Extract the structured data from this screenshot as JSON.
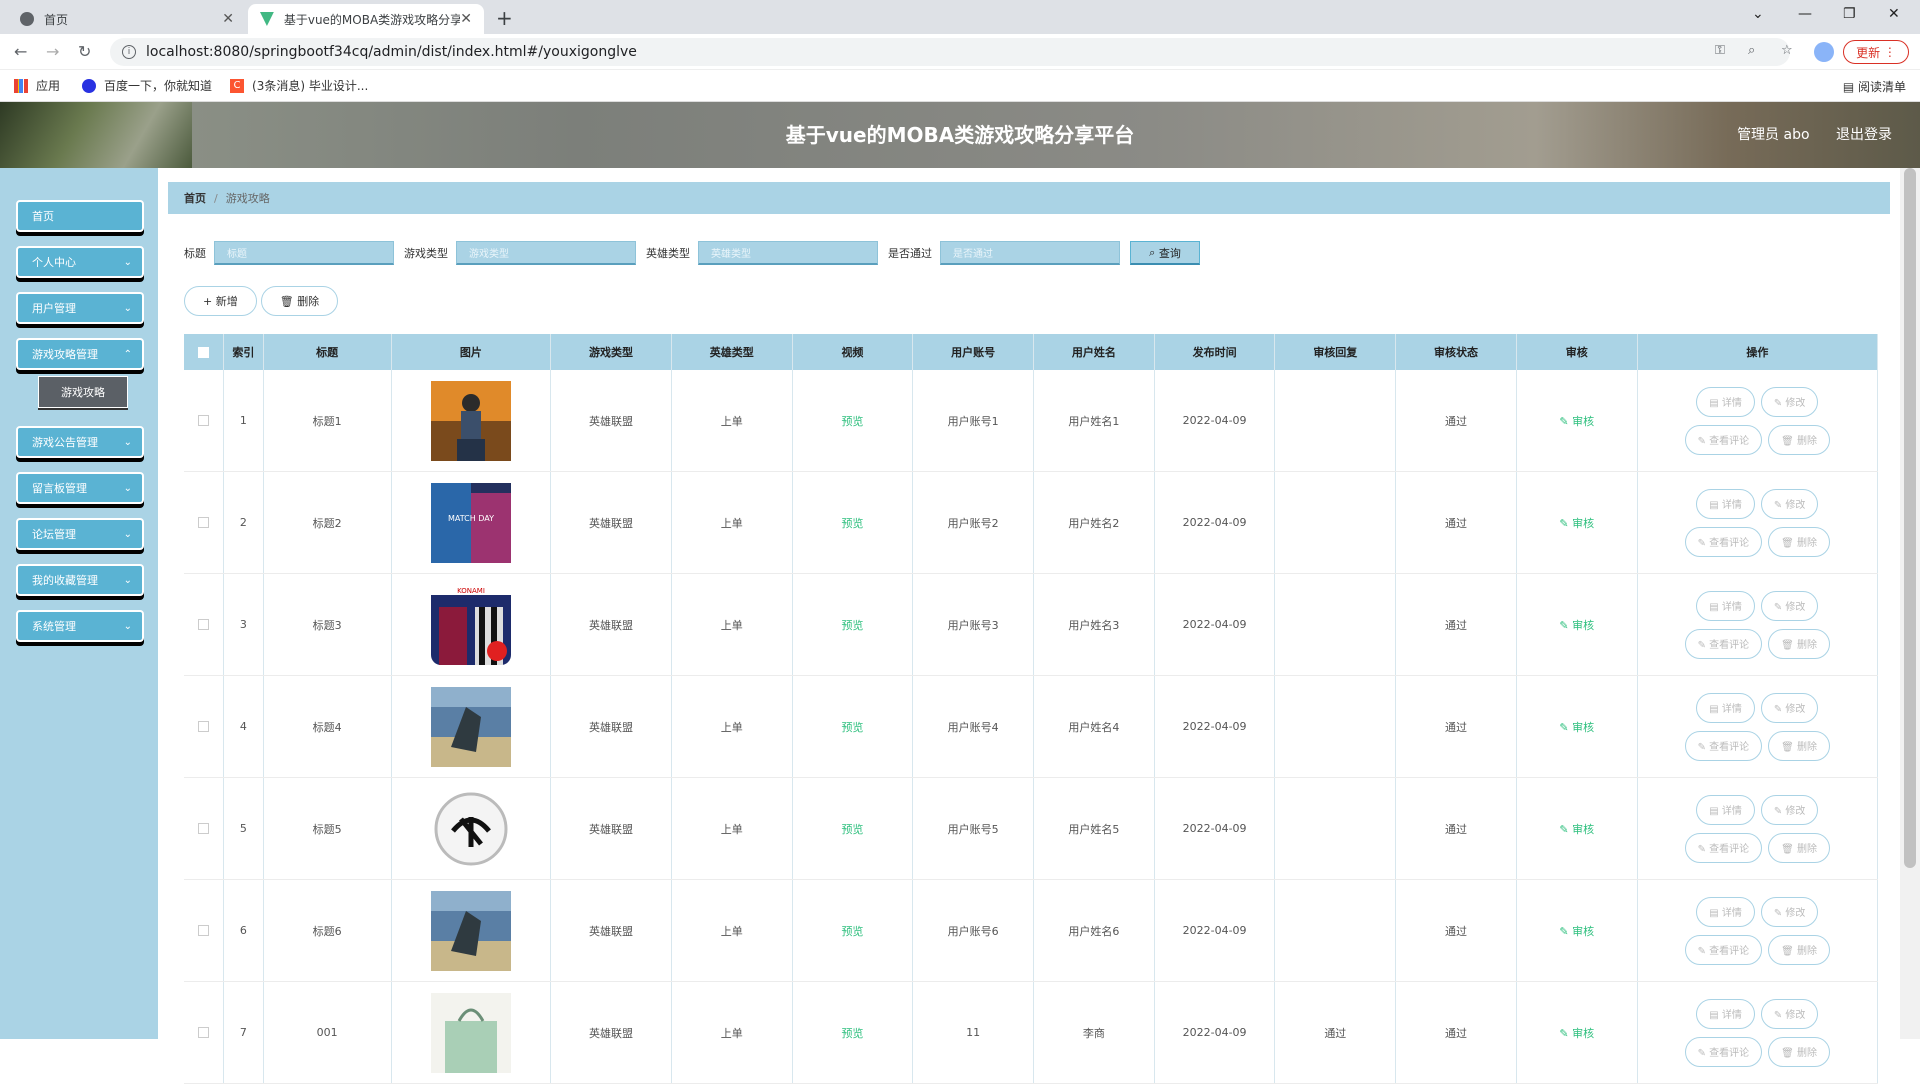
{
  "browser": {
    "tabs": [
      {
        "title": "首页"
      },
      {
        "title": "基于vue的MOBA类游戏攻略分享"
      }
    ],
    "url": "localhost:8080/springbootf34cq/admin/dist/index.html#/youxigonglve",
    "update_label": "更新",
    "bookmarks": [
      {
        "label": "应用"
      },
      {
        "label": "百度一下，你就知道"
      },
      {
        "label": "(3条消息) 毕业设计..."
      }
    ],
    "reading_list": "阅读清单"
  },
  "header": {
    "title": "基于vue的MOBA类游戏攻略分享平台",
    "user": "管理员 abo",
    "logout": "退出登录"
  },
  "sidebar": {
    "items": [
      {
        "label": "首页"
      },
      {
        "label": "个人中心"
      },
      {
        "label": "用户管理"
      },
      {
        "label": "游戏攻略管理"
      },
      {
        "label": "游戏公告管理"
      },
      {
        "label": "留言板管理"
      },
      {
        "label": "论坛管理"
      },
      {
        "label": "我的收藏管理"
      },
      {
        "label": "系统管理"
      }
    ],
    "sub_item": "游戏攻略"
  },
  "breadcrumb": {
    "home": "首页",
    "current": "游戏攻略"
  },
  "search": {
    "title_label": "标题",
    "title_placeholder": "标题",
    "game_type_label": "游戏类型",
    "game_type_placeholder": "游戏类型",
    "hero_type_label": "英雄类型",
    "hero_type_placeholder": "英雄类型",
    "passed_label": "是否通过",
    "passed_placeholder": "是否通过",
    "query_label": "查询"
  },
  "actions": {
    "add": "新增",
    "delete": "删除"
  },
  "table": {
    "headers": [
      "索引",
      "标题",
      "图片",
      "游戏类型",
      "英雄类型",
      "视频",
      "用户账号",
      "用户姓名",
      "发布时间",
      "审核回复",
      "审核状态",
      "审核",
      "操作"
    ],
    "rows": [
      {
        "index": "1",
        "title": "标题1",
        "game_type": "英雄联盟",
        "hero_type": "上单",
        "video": "预览",
        "account": "用户账号1",
        "name": "用户姓名1",
        "date": "2022-04-09",
        "reply": "",
        "status": "通过",
        "audit": "审核",
        "img": "pubg"
      },
      {
        "index": "2",
        "title": "标题2",
        "game_type": "英雄联盟",
        "hero_type": "上单",
        "video": "预览",
        "account": "用户账号2",
        "name": "用户姓名2",
        "date": "2022-04-09",
        "reply": "",
        "status": "通过",
        "audit": "审核",
        "img": "matchday"
      },
      {
        "index": "3",
        "title": "标题3",
        "game_type": "英雄联盟",
        "hero_type": "上单",
        "video": "预览",
        "account": "用户账号3",
        "name": "用户姓名3",
        "date": "2022-04-09",
        "reply": "",
        "status": "通过",
        "audit": "审核",
        "img": "konami"
      },
      {
        "index": "4",
        "title": "标题4",
        "game_type": "英雄联盟",
        "hero_type": "上单",
        "video": "预览",
        "account": "用户账号4",
        "name": "用户姓名4",
        "date": "2022-04-09",
        "reply": "",
        "status": "通过",
        "audit": "审核",
        "img": "scene"
      },
      {
        "index": "5",
        "title": "标题5",
        "game_type": "英雄联盟",
        "hero_type": "上单",
        "video": "预览",
        "account": "用户账号5",
        "name": "用户姓名5",
        "date": "2022-04-09",
        "reply": "",
        "status": "通过",
        "audit": "审核",
        "img": "logo"
      },
      {
        "index": "6",
        "title": "标题6",
        "game_type": "英雄联盟",
        "hero_type": "上单",
        "video": "预览",
        "account": "用户账号6",
        "name": "用户姓名6",
        "date": "2022-04-09",
        "reply": "",
        "status": "通过",
        "audit": "审核",
        "img": "scene"
      },
      {
        "index": "7",
        "title": "001",
        "game_type": "英雄联盟",
        "hero_type": "上单",
        "video": "预览",
        "account": "11",
        "name": "李商",
        "date": "2022-04-09",
        "reply": "通过",
        "status": "通过",
        "audit": "审核",
        "img": "bag"
      }
    ],
    "ops": {
      "detail": "详情",
      "edit": "修改",
      "comments": "查看评论",
      "delete": "删除"
    }
  },
  "colors": {
    "accent": "#aad3e5",
    "menu": "#5ab3d3",
    "green": "#2dbf7d"
  }
}
